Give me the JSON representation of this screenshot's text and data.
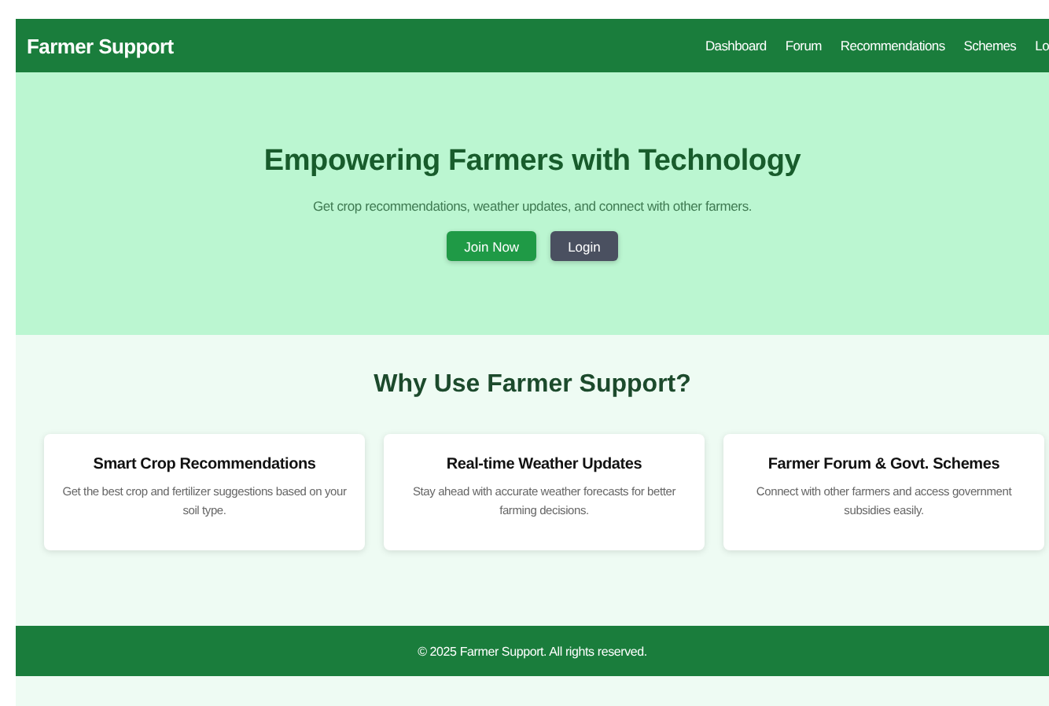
{
  "navbar": {
    "brand": "Farmer Support",
    "links": [
      "Dashboard",
      "Forum",
      "Recommendations",
      "Schemes",
      "Lo"
    ]
  },
  "hero": {
    "title": "Empowering Farmers with Technology",
    "subtitle": "Get crop recommendations, weather updates, and connect with other farmers.",
    "buttons": [
      {
        "label": "Join Now",
        "kind": "primary"
      },
      {
        "label": "Login",
        "kind": "secondary"
      }
    ]
  },
  "features": {
    "heading": "Why Use Farmer Support?",
    "cards": [
      {
        "title": "Smart Crop Recommendations",
        "text": "Get the best crop and fertilizer suggestions based on your soil type."
      },
      {
        "title": "Real-time Weather Updates",
        "text": "Stay ahead with accurate weather forecasts for better farming decisions."
      },
      {
        "title": "Farmer Forum & Govt. Schemes",
        "text": "Connect with other farmers and access government subsidies easily."
      }
    ]
  },
  "footer": {
    "text": "© 2025 Farmer Support. All rights reserved."
  }
}
